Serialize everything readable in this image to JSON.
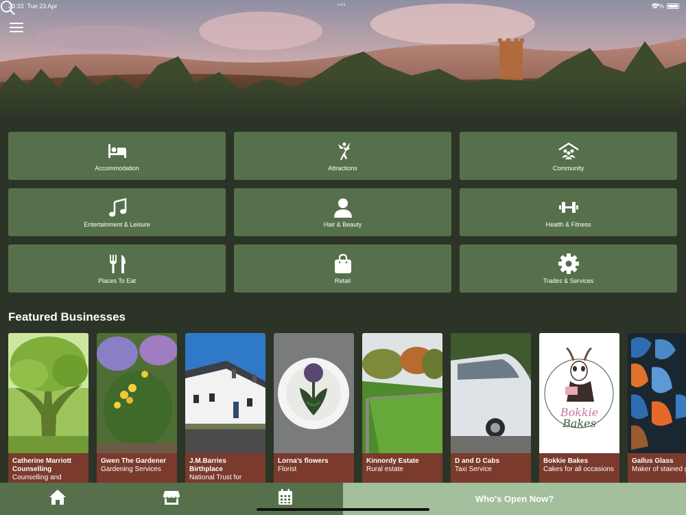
{
  "status": {
    "time": "23:33",
    "date": "Tue 23 Apr",
    "dots": "•••",
    "battery": "97%"
  },
  "header": {
    "menu_icon": "hamburger-icon",
    "search_icon": "search-icon"
  },
  "categories": [
    {
      "label": "Accommodation",
      "icon": "bed-icon"
    },
    {
      "label": "Attractions",
      "icon": "fairy-icon"
    },
    {
      "label": "Community",
      "icon": "community-icon"
    },
    {
      "label": "Entertainment & Leisure",
      "icon": "music-icon"
    },
    {
      "label": "Hair & Beauty",
      "icon": "person-icon"
    },
    {
      "label": "Health & Fitness",
      "icon": "dumbbell-icon"
    },
    {
      "label": "Places To Eat",
      "icon": "cutlery-icon"
    },
    {
      "label": "Retail",
      "icon": "shopping-bag-icon"
    },
    {
      "label": "Trades & Services",
      "icon": "gear-icon"
    }
  ],
  "featured": {
    "title": "Featured Businesses",
    "items": [
      {
        "name": "Catherine Marriott Counselling",
        "sub": "Counselling and"
      },
      {
        "name": "Gwen The Gardener",
        "sub": "Gardening Services"
      },
      {
        "name": "J.M.Barries Birthplace",
        "sub": "National Trust for"
      },
      {
        "name": "Lorna’s flowers",
        "sub": "Florist"
      },
      {
        "name": "Kinnordy Estate",
        "sub": "Rural estate"
      },
      {
        "name": "D and D Cabs",
        "sub": "Taxi Service"
      },
      {
        "name": "Bokkie Bakes",
        "sub": "Cakes for all occasions"
      },
      {
        "name": "Gallus Glass",
        "sub": "Maker of stained glass"
      }
    ],
    "bokkie_logo_line1": "Bokkie",
    "bokkie_logo_line2": "Bakes"
  },
  "bottom_nav": {
    "home_icon": "home-icon",
    "store_icon": "store-icon",
    "calendar_icon": "calendar-icon",
    "who_open_label": "Who's Open Now?"
  },
  "colors": {
    "background": "#2b3427",
    "tile": "#56704b",
    "card_footer": "#7a3a2c",
    "who_open": "#a3bf9c"
  }
}
